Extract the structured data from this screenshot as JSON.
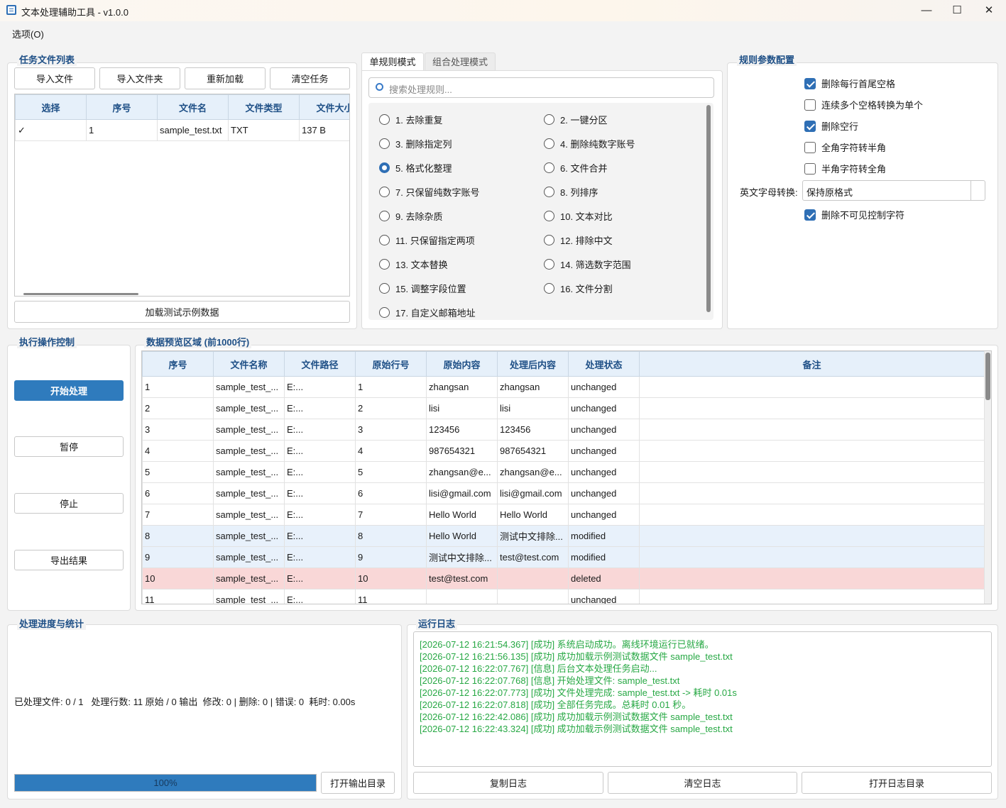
{
  "window": {
    "title": "文本处理辅助工具 - v1.0.0",
    "minimize": "—",
    "maximize": "☐",
    "close": "✕"
  },
  "menu": {
    "options": "选项(O)"
  },
  "task_files": {
    "title": "任务文件列表",
    "buttons": {
      "import_file": "导入文件",
      "import_folder": "导入文件夹",
      "reload": "重新加载",
      "clear": "清空任务"
    },
    "columns": [
      "选择",
      "序号",
      "文件名",
      "文件类型",
      "文件大小"
    ],
    "rows": [
      {
        "check": "✓",
        "index": "1",
        "name": "sample_test.txt",
        "type": "TXT",
        "size": "137 B"
      }
    ],
    "load_sample": "加载测试示例数据"
  },
  "modes": {
    "tab_single": "单规则模式",
    "tab_combo": "组合处理模式",
    "search_placeholder": "搜索处理规则..."
  },
  "rules": [
    "1. 去除重复",
    "2. 一键分区",
    "3. 删除指定列",
    "4. 删除纯数字账号",
    "5. 格式化整理",
    "6. 文件合并",
    "7. 只保留纯数字账号",
    "8. 列排序",
    "9. 去除杂质",
    "10. 文本对比",
    "11. 只保留指定两项",
    "12. 排除中文",
    "13. 文本替换",
    "14. 筛选数字范围",
    "15. 调整字段位置",
    "16. 文件分割",
    "17. 自定义邮箱地址"
  ],
  "selected_rule": "5. 格式化整理",
  "params": {
    "title": "规则参数配置",
    "options": [
      {
        "label": "删除每行首尾空格",
        "checked": true
      },
      {
        "label": "连续多个空格转换为单个",
        "checked": false
      },
      {
        "label": "删除空行",
        "checked": true
      },
      {
        "label": "全角字符转半角",
        "checked": false
      },
      {
        "label": "半角字符转全角",
        "checked": false
      }
    ],
    "case_label": "英文字母转换:",
    "case_value": "保持原格式",
    "invisible": {
      "label": "删除不可见控制字符",
      "checked": true
    }
  },
  "controls": {
    "title": "执行操作控制",
    "start": "开始处理",
    "pause": "暂停",
    "stop": "停止",
    "export": "导出结果"
  },
  "preview": {
    "title": "数据预览区域 (前1000行)",
    "columns": [
      "序号",
      "文件名称",
      "文件路径",
      "原始行号",
      "原始内容",
      "处理后内容",
      "处理状态",
      "备注"
    ],
    "rows": [
      {
        "i": "1",
        "f": "sample_test_...",
        "p": "E:...",
        "l": "1",
        "o": "zhangsan",
        "n": "zhangsan",
        "s": "unchanged",
        "r": ""
      },
      {
        "i": "2",
        "f": "sample_test_...",
        "p": "E:...",
        "l": "2",
        "o": "lisi",
        "n": "lisi",
        "s": "unchanged",
        "r": ""
      },
      {
        "i": "3",
        "f": "sample_test_...",
        "p": "E:...",
        "l": "3",
        "o": "123456",
        "n": "123456",
        "s": "unchanged",
        "r": ""
      },
      {
        "i": "4",
        "f": "sample_test_...",
        "p": "E:...",
        "l": "4",
        "o": "987654321",
        "n": "987654321",
        "s": "unchanged",
        "r": ""
      },
      {
        "i": "5",
        "f": "sample_test_...",
        "p": "E:...",
        "l": "5",
        "o": "zhangsan@e...",
        "n": "zhangsan@e...",
        "s": "unchanged",
        "r": ""
      },
      {
        "i": "6",
        "f": "sample_test_...",
        "p": "E:...",
        "l": "6",
        "o": "lisi@gmail.com",
        "n": "lisi@gmail.com",
        "s": "unchanged",
        "r": ""
      },
      {
        "i": "7",
        "f": "sample_test_...",
        "p": "E:...",
        "l": "7",
        "o": "Hello World",
        "n": "Hello World",
        "s": "unchanged",
        "r": ""
      },
      {
        "i": "8",
        "f": "sample_test_...",
        "p": "E:...",
        "l": "8",
        "o": "Hello World",
        "n": "测试中文排除...",
        "s": "modified",
        "r": ""
      },
      {
        "i": "9",
        "f": "sample_test_...",
        "p": "E:...",
        "l": "9",
        "o": "测试中文排除...",
        "n": "test@test.com",
        "s": "modified",
        "r": ""
      },
      {
        "i": "10",
        "f": "sample_test_...",
        "p": "E:...",
        "l": "10",
        "o": "test@test.com",
        "n": "",
        "s": "deleted",
        "r": ""
      },
      {
        "i": "11",
        "f": "sample_test_...",
        "p": "E:...",
        "l": "11",
        "o": "",
        "n": "",
        "s": "unchanged",
        "r": ""
      }
    ]
  },
  "progress": {
    "title": "处理进度与统计",
    "stats": "已处理文件: 0 / 1   处理行数: 11 原始 / 0 输出  修改: 0 | 删除: 0 | 错误: 0  耗时: 0.00s",
    "percent": 100,
    "percent_label": "100%",
    "open_output": "打开输出目录"
  },
  "log": {
    "title": "运行日志",
    "lines": [
      "[2026-07-12 16:21:54.367] [成功] 系统启动成功。离线环境运行已就绪。",
      "[2026-07-12 16:21:56.135] [成功] 成功加载示例测试数据文件 sample_test.txt",
      "[2026-07-12 16:22:07.767] [信息] 后台文本处理任务启动...",
      "[2026-07-12 16:22:07.768] [信息] 开始处理文件: sample_test.txt",
      "[2026-07-12 16:22:07.773] [成功] 文件处理完成: sample_test.txt -> 耗时 0.01s",
      "[2026-07-12 16:22:07.818] [成功] 全部任务完成。总耗时 0.01 秒。",
      "[2026-07-12 16:22:42.086] [成功] 成功加载示例测试数据文件 sample_test.txt",
      "[2026-07-12 16:22:43.324] [成功] 成功加载示例测试数据文件 sample_test.txt"
    ],
    "copy": "复制日志",
    "clear": "清空日志",
    "open_dir": "打开日志目录"
  }
}
